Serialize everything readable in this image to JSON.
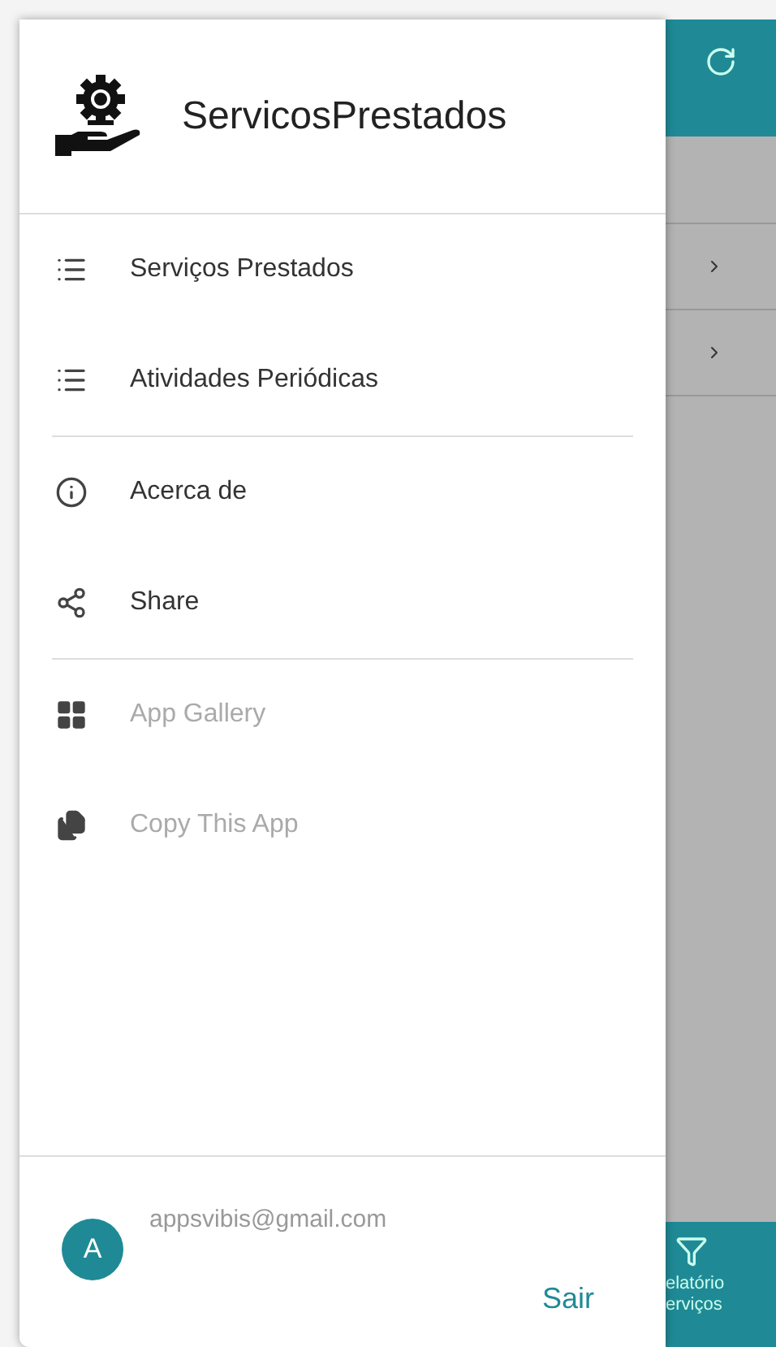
{
  "drawer": {
    "title": "ServicosPrestados",
    "groups": [
      [
        {
          "label": "Serviços Prestados",
          "kind": "list",
          "disabled": false
        },
        {
          "label": "Atividades Periódicas",
          "kind": "list",
          "disabled": false
        }
      ],
      [
        {
          "label": "Acerca de",
          "kind": "info",
          "disabled": false
        },
        {
          "label": "Share",
          "kind": "share",
          "disabled": false
        }
      ],
      [
        {
          "label": "App Gallery",
          "kind": "grid",
          "disabled": true
        },
        {
          "label": "Copy This App",
          "kind": "copy",
          "disabled": true
        }
      ]
    ],
    "account": {
      "initial": "A",
      "email": "appsvibis@gmail.com"
    },
    "logout": "Sair"
  },
  "background": {
    "bottom_tab": {
      "lines": [
        "elatório",
        "erviços"
      ]
    }
  }
}
